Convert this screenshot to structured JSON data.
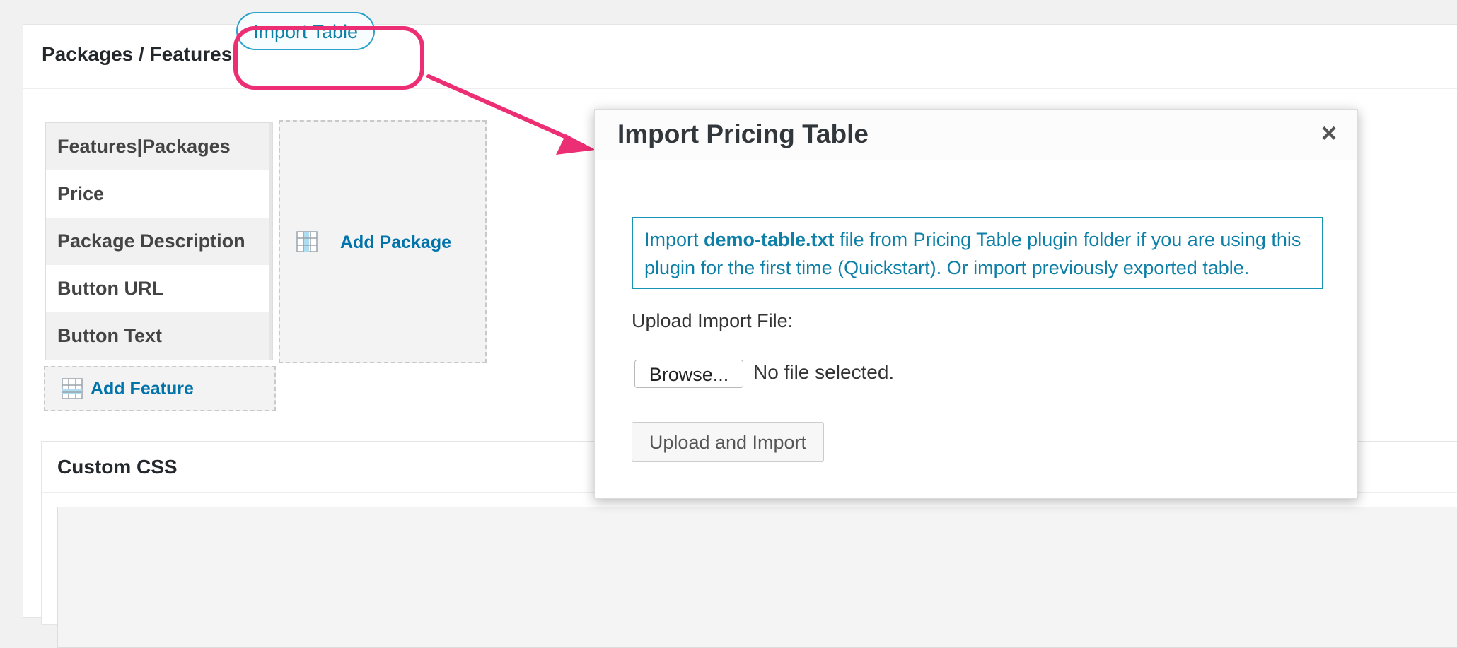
{
  "header": {
    "title": "Packages / Features",
    "import_button_label": "Import Table"
  },
  "features_table": {
    "rows": [
      {
        "label": "Features|Packages"
      },
      {
        "label": "Price"
      },
      {
        "label": "Package Description"
      },
      {
        "label": "Button URL"
      },
      {
        "label": "Button Text"
      }
    ],
    "add_feature_label": "Add Feature",
    "add_package_label": "Add Package"
  },
  "custom_css": {
    "title": "Custom CSS"
  },
  "modal": {
    "title": "Import Pricing Table",
    "close_symbol": "×",
    "info_prefix": "Import ",
    "info_filename": "demo-table.txt",
    "info_suffix": " file from Pricing Table plugin folder if you are using this plugin for the first time (Quickstart). Or import previously exported table.",
    "upload_label": "Upload Import File:",
    "browse_label": "Browse...",
    "file_status": "No file selected.",
    "submit_label": "Upload and Import"
  },
  "annotation": {
    "highlight_color": "#ec2e74"
  },
  "colors": {
    "accent": "#0073aa",
    "info_text": "#0e7fa6"
  }
}
